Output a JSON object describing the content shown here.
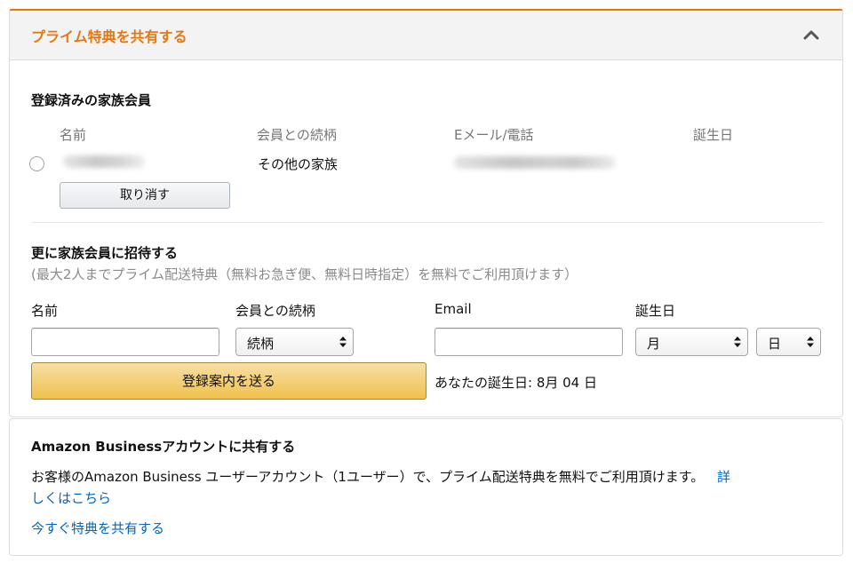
{
  "header": {
    "title": "プライム特典を共有する",
    "collapse_icon": "chevron-up-icon",
    "accent_color": "#e47911"
  },
  "registered": {
    "heading": "登録済みの家族会員",
    "columns": [
      "名前",
      "会員との続柄",
      "Eメール/電話",
      "誕生日"
    ],
    "member": {
      "relationship": "その他の家族"
    },
    "cancel_label": "取り消す"
  },
  "invite": {
    "heading": "更に家族会員に招待する",
    "subtext": "(最大2人までプライム配送特典（無料お急ぎ便、無料日時指定）を無料でご利用頂けます）",
    "labels": {
      "name": "名前",
      "relationship": "会員との続柄",
      "email": "Email",
      "birthday": "誕生日"
    },
    "inputs": {
      "name_value": "",
      "email_value": ""
    },
    "selects": {
      "relationship": "続柄",
      "month": "月",
      "day": "日"
    },
    "send_label": "登録案内を送る",
    "birthday_note": "あなたの誕生日: 8月 04 日"
  },
  "business": {
    "heading": "Amazon Businessアカウントに共有する",
    "body_line1": "お客様のAmazon Business ユーザーアカウント（1ユーザー）で、プライム配送特典を無料でご利用頂けます。",
    "details_link_part1": "詳",
    "details_link_part2": "しくはこちら",
    "share_link": "今すぐ特典を共有する",
    "link_color": "#0066c0"
  }
}
